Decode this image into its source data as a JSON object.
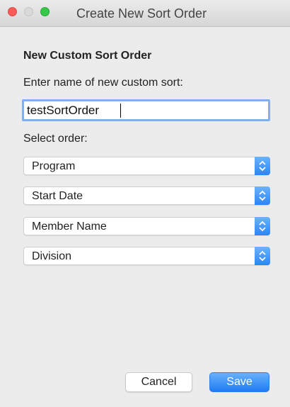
{
  "window": {
    "title": "Create New Sort Order"
  },
  "form": {
    "heading": "New Custom Sort Order",
    "name_prompt": "Enter name of new custom sort:",
    "name_value": "testSortOrder",
    "order_label": "Select order:",
    "selects": [
      {
        "value": "Program"
      },
      {
        "value": "Start Date"
      },
      {
        "value": "Member Name"
      },
      {
        "value": "Division"
      }
    ]
  },
  "buttons": {
    "cancel_label": "Cancel",
    "save_label": "Save"
  },
  "colors": {
    "accent": "#2d84f5",
    "focus_ring": "#7fb1f1"
  }
}
